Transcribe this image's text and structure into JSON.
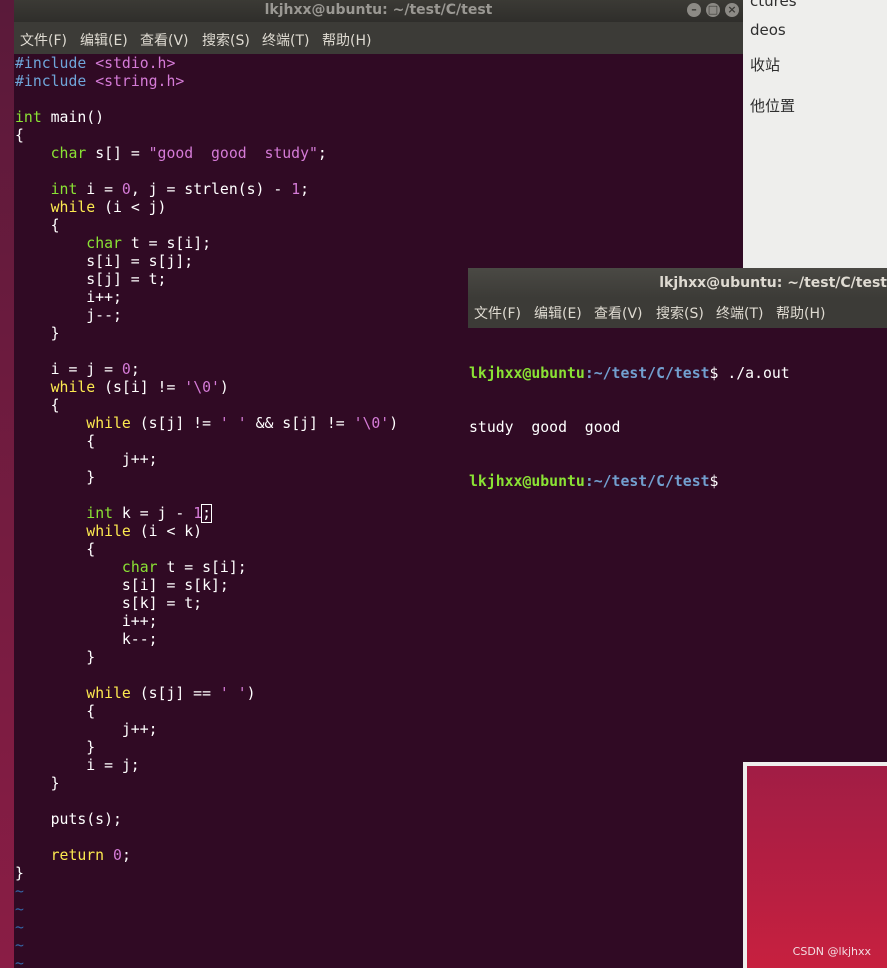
{
  "file_manager": {
    "items": [
      "ctures",
      "deos",
      "收站",
      "他位置"
    ]
  },
  "editor_window": {
    "title": "lkjhxx@ubuntu: ~/test/C/test",
    "menu": [
      "文件(F)",
      "编辑(E)",
      "查看(V)",
      "搜索(S)",
      "终端(T)",
      "帮助(H)"
    ],
    "code_lines": [
      "#include <stdio.h>",
      "#include <string.h>",
      "",
      "int main()",
      "{",
      "    char s[] = \"good  good  study\";",
      "",
      "    int i = 0, j = strlen(s) - 1;",
      "    while (i < j)",
      "    {",
      "        char t = s[i];",
      "        s[i] = s[j];",
      "        s[j] = t;",
      "        i++;",
      "        j--;",
      "    }",
      "",
      "    i = j = 0;",
      "    while (s[i] != '\\0')",
      "    {",
      "        while (s[j] != ' ' && s[j] != '\\0')",
      "        {",
      "            j++;",
      "        }",
      "",
      "        int k = j - 1;",
      "        while (i < k)",
      "        {",
      "            char t = s[i];",
      "            s[i] = s[k];",
      "            s[k] = t;",
      "            i++;",
      "            k--;",
      "        }",
      "",
      "        while (s[j] == ' ')",
      "        {",
      "            j++;",
      "        }",
      "        i = j;",
      "    }",
      "",
      "    puts(s);",
      "",
      "    return 0;",
      "}",
      "~",
      "~",
      "~",
      "~",
      "~"
    ]
  },
  "terminal_window": {
    "title": "lkjhxx@ubuntu: ~/test/C/test",
    "menu": [
      "文件(F)",
      "编辑(E)",
      "查看(V)",
      "搜索(S)",
      "终端(T)",
      "帮助(H)"
    ],
    "prompt_user": "lkjhxx@ubuntu",
    "prompt_path": ":~/test/C/test",
    "prompt_sign": "$",
    "command": " ./a.out",
    "output": "study  good  good"
  },
  "watermark": "CSDN @lkjhxx",
  "colors": {
    "terminal_bg": "#300a24",
    "menubar": "#3c3b37",
    "keyword": "#fce94f",
    "type": "#8ae234",
    "preprocessor": "#6fa5d9",
    "string_number": "#d57bd7",
    "tilde": "#3465a4",
    "prompt_user": "#8ae234",
    "prompt_path": "#729fcf"
  }
}
